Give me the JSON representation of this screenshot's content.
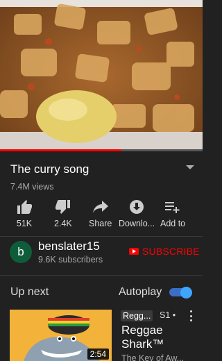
{
  "video": {
    "progress_fraction": 0.6
  },
  "info": {
    "title": "The curry song",
    "views": "7.4M views"
  },
  "actions": [
    {
      "label": "51K",
      "icon": "thumbs-up-icon"
    },
    {
      "label": "2.4K",
      "icon": "thumbs-down-icon"
    },
    {
      "label": "Share",
      "icon": "share-icon"
    },
    {
      "label": "Downlo...",
      "icon": "download-icon"
    },
    {
      "label": "Add to",
      "icon": "add-to-playlist-icon"
    }
  ],
  "channel": {
    "avatar_letter": "b",
    "name": "benslater15",
    "subscribers": "9.6K subscribers",
    "subscribe_label": "SUBSCRIBE"
  },
  "upnext": {
    "heading": "Up next",
    "autoplay_label": "Autoplay",
    "autoplay_on": true
  },
  "recommendation": {
    "duration": "2:54",
    "badge": "Regg...",
    "badge2": "S1 •",
    "title": "Reggae Shark™",
    "subtitle": "The Key of Aw..."
  },
  "colors": {
    "background": "#212121",
    "accent_red": "#ff0000",
    "toggle_blue": "#3ea6ff"
  }
}
